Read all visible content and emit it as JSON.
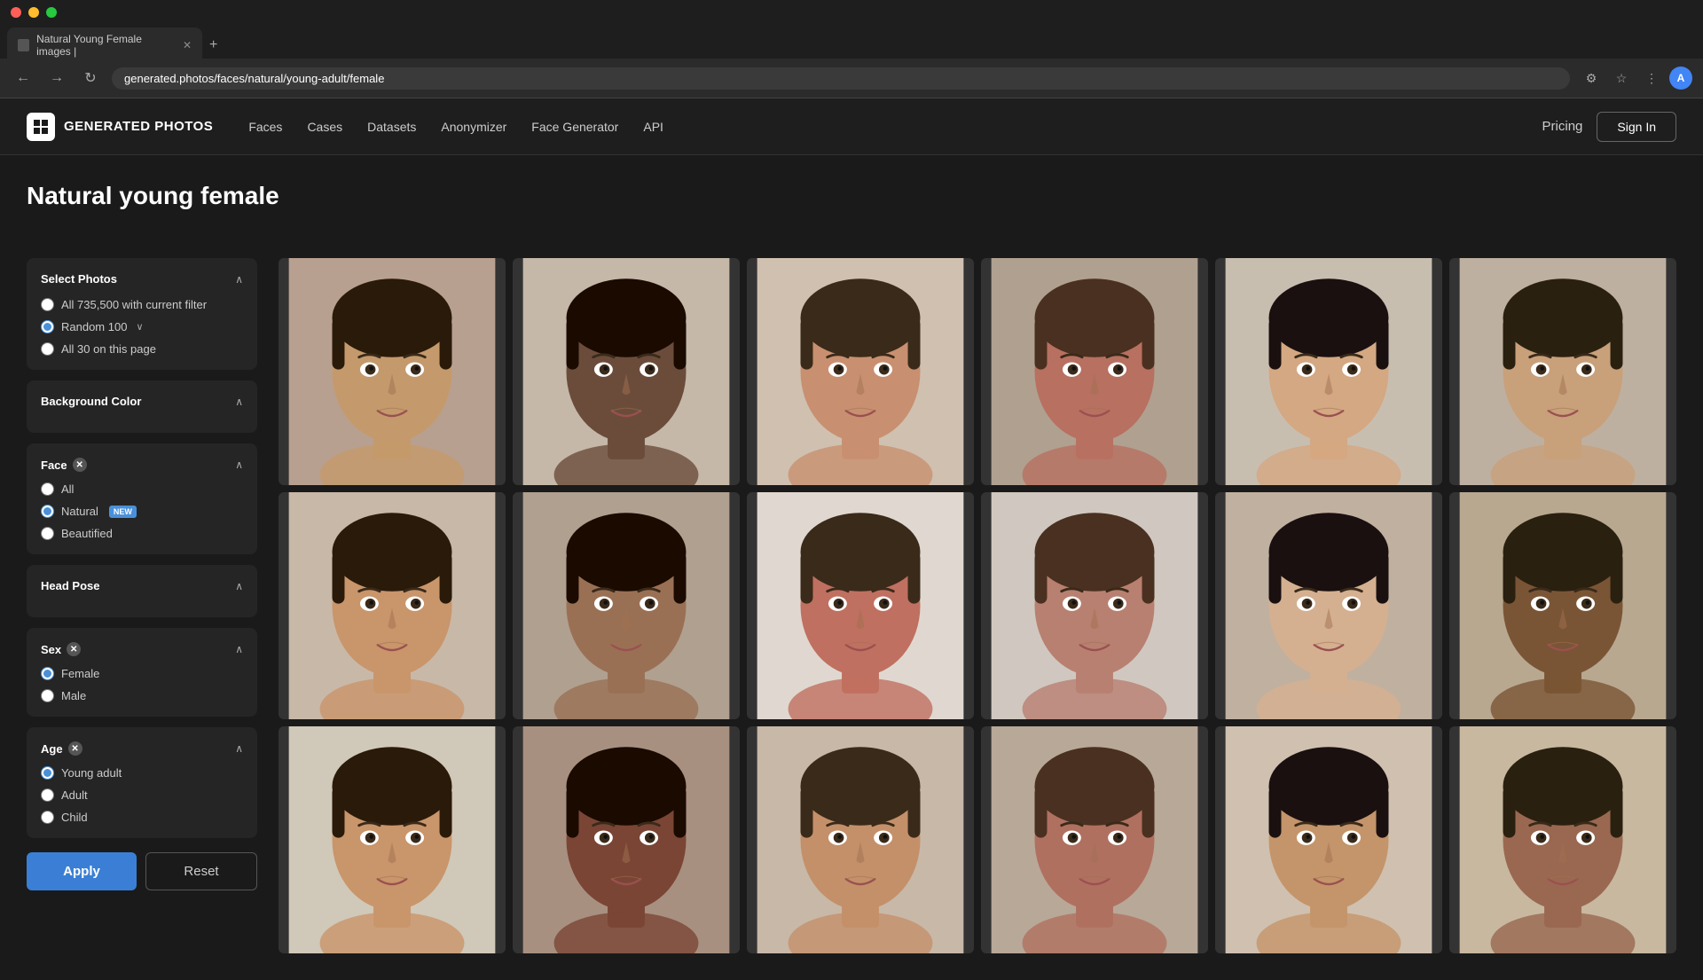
{
  "browser": {
    "tab_title": "Natural Young Female images |",
    "url": "generated.photos/faces/natural/young-adult/female",
    "new_tab_label": "+",
    "nav_back": "←",
    "nav_forward": "→",
    "nav_refresh": "↻"
  },
  "nav": {
    "logo_text": "GENERATED PHOTOS",
    "logo_icon": "G",
    "links": [
      "Faces",
      "Cases",
      "Datasets",
      "Anonymizer",
      "Face Generator",
      "API"
    ],
    "pricing": "Pricing",
    "signin": "Sign In"
  },
  "page": {
    "title": "Natural young female"
  },
  "sidebar": {
    "select_photos": {
      "title": "Select Photos",
      "options": [
        "All 735,500 with current filter",
        "Random 100",
        "All 30 on this page"
      ]
    },
    "background_color": {
      "title": "Background Color"
    },
    "face": {
      "title": "Face",
      "options": [
        "All",
        "Natural",
        "Beautified"
      ],
      "selected": "Natural",
      "new_badge": "NEW"
    },
    "head_pose": {
      "title": "Head Pose"
    },
    "sex": {
      "title": "Sex",
      "options": [
        "Female",
        "Male"
      ],
      "selected": "Female"
    },
    "age": {
      "title": "Age",
      "options": [
        "Young adult",
        "Adult",
        "Child"
      ],
      "selected": "Young adult"
    },
    "apply_label": "Apply",
    "reset_label": "Reset"
  },
  "grid": {
    "rows": 3,
    "cols": 6,
    "face_colors": [
      [
        "#c9956a",
        "#8b6b4a",
        "#c4956a",
        "#c07a5a",
        "#d4a882",
        "#c8a07a"
      ],
      [
        "#c9956a",
        "#9a7055",
        "#c07060",
        "#b88070",
        "#d4b090",
        "#8a6040"
      ],
      [
        "#c9956a",
        "#7a5035",
        "#c4906a",
        "#b07060",
        "#c4956a",
        "#9a7060"
      ]
    ]
  }
}
